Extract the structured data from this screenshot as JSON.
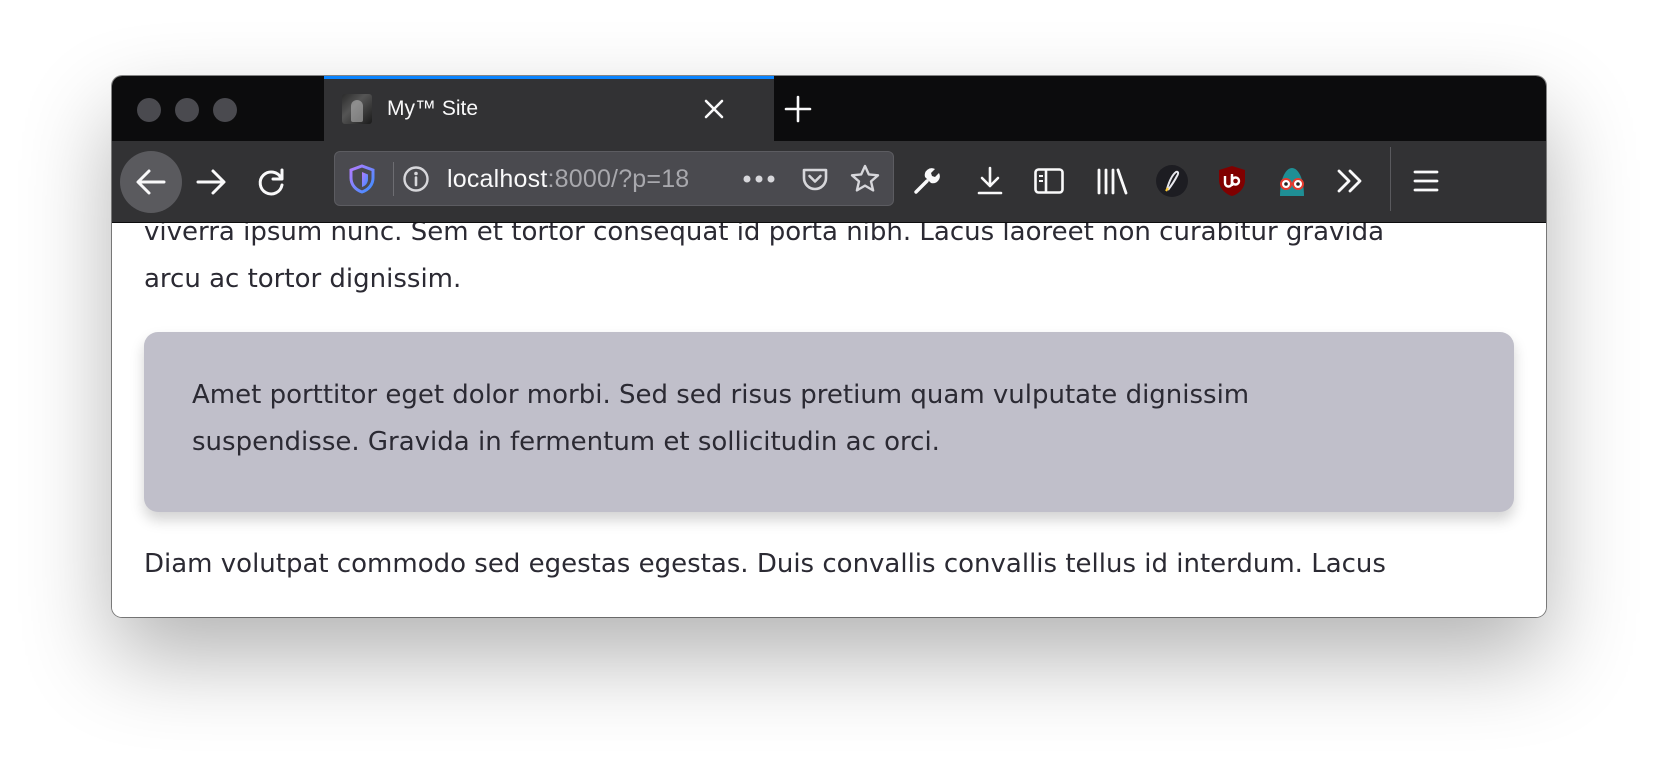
{
  "browser": {
    "tab": {
      "title": "My™ Site",
      "favicon": "site-favicon-icon",
      "active_indicator_color": "#0a84ff"
    },
    "new_tab_icon": "plus-icon",
    "nav": {
      "back_icon": "arrow-left-icon",
      "forward_icon": "arrow-right-icon",
      "reload_icon": "reload-icon"
    },
    "urlbar": {
      "url_host": "localhost",
      "url_rest": ":8000/?p=18",
      "shield_icon": "shield-icon",
      "info_icon": "info-icon",
      "page_actions_icon": "more-icon",
      "pocket_icon": "pocket-icon",
      "bookmark_icon": "star-icon"
    },
    "toolbar_icons": [
      "wrench-icon",
      "download-icon",
      "sidebar-icon",
      "library-icon",
      "extension-pen-icon",
      "ublock-origin-icon",
      "extension-mascot-icon",
      "overflow-chevrons-icon",
      "hamburger-menu-icon"
    ]
  },
  "page": {
    "paragraph_top": "viverra ipsum nunc. Sem et tortor consequat id porta nibh. Lacus laoreet non curabitur gravida arcu ac tortor dignissim.",
    "callout_text": "Amet porttitor eget dolor morbi. Sed sed risus pretium quam vulputate dignissim suspendisse. Gravida in fermentum et sollicitudin ac orci.",
    "paragraph_bottom": "Diam volutpat commodo sed egestas egestas. Duis convallis convallis tellus id interdum. Lacus",
    "callout_bg_color": "#c0bfca",
    "text_color": "#2b2a33"
  }
}
